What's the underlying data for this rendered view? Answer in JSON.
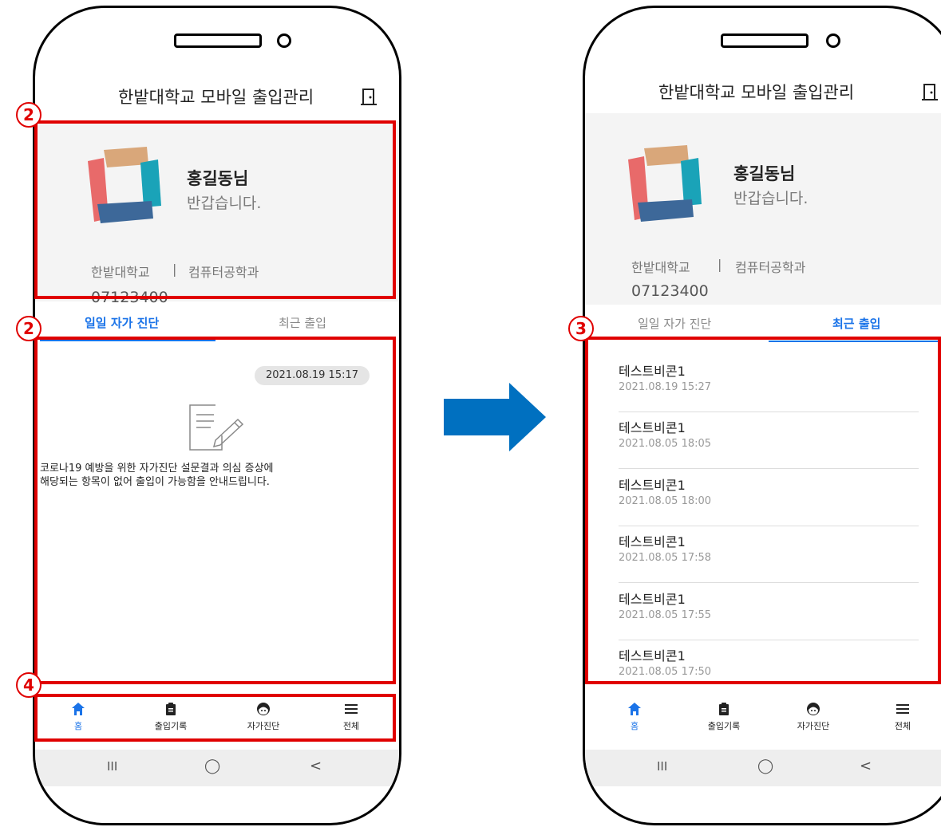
{
  "app": {
    "title": "한밭대학교 모바일 출입관리"
  },
  "profile": {
    "name": "홍길동님",
    "greeting": "반갑습니다.",
    "school": "한밭대학교",
    "separator": "|",
    "department": "컴퓨터공학과",
    "student_id": "07123400"
  },
  "tabs": {
    "self_diagnosis": "일일 자가 진단",
    "recent_entry": "최근 출입"
  },
  "diagnosis": {
    "date": "2021.08.19 15:17",
    "message_line1": "코로나19 예방을 위한 자가진단 설문결과 의심 증상에",
    "message_line2": "해당되는 항목이 없어 출입이 가능함을 안내드립니다."
  },
  "recent_entries": [
    {
      "name": "테스트비콘1",
      "time": "2021.08.19   15:27"
    },
    {
      "name": "테스트비콘1",
      "time": "2021.08.05   18:05"
    },
    {
      "name": "테스트비콘1",
      "time": "2021.08.05   18:00"
    },
    {
      "name": "테스트비콘1",
      "time": "2021.08.05   17:58"
    },
    {
      "name": "테스트비콘1",
      "time": "2021.08.05   17:55"
    },
    {
      "name": "테스트비콘1",
      "time": "2021.08.05   17:50"
    }
  ],
  "nav": {
    "home": "홈",
    "entry_log": "출입기록",
    "self_check": "자가진단",
    "all": "전체"
  },
  "sysbar": {
    "recent": "III",
    "home": "◯",
    "back": "<"
  },
  "annotations": {
    "badge_2": "2",
    "badge_3": "3",
    "badge_4": "4"
  },
  "icons": {
    "exit": "door-exit-icon",
    "home": "home-icon",
    "clipboard": "clipboard-icon",
    "face": "face-icon",
    "menu": "menu-icon",
    "document": "document-pen-icon",
    "arrow": "right-arrow-icon"
  },
  "colors": {
    "accent": "#1a73e8",
    "annotation": "#e00000",
    "arrow": "#0070c0",
    "logo_red": "#e86a6a",
    "logo_tan": "#d9a77a",
    "logo_teal": "#1aa3b8",
    "logo_navy": "#3d6899"
  }
}
